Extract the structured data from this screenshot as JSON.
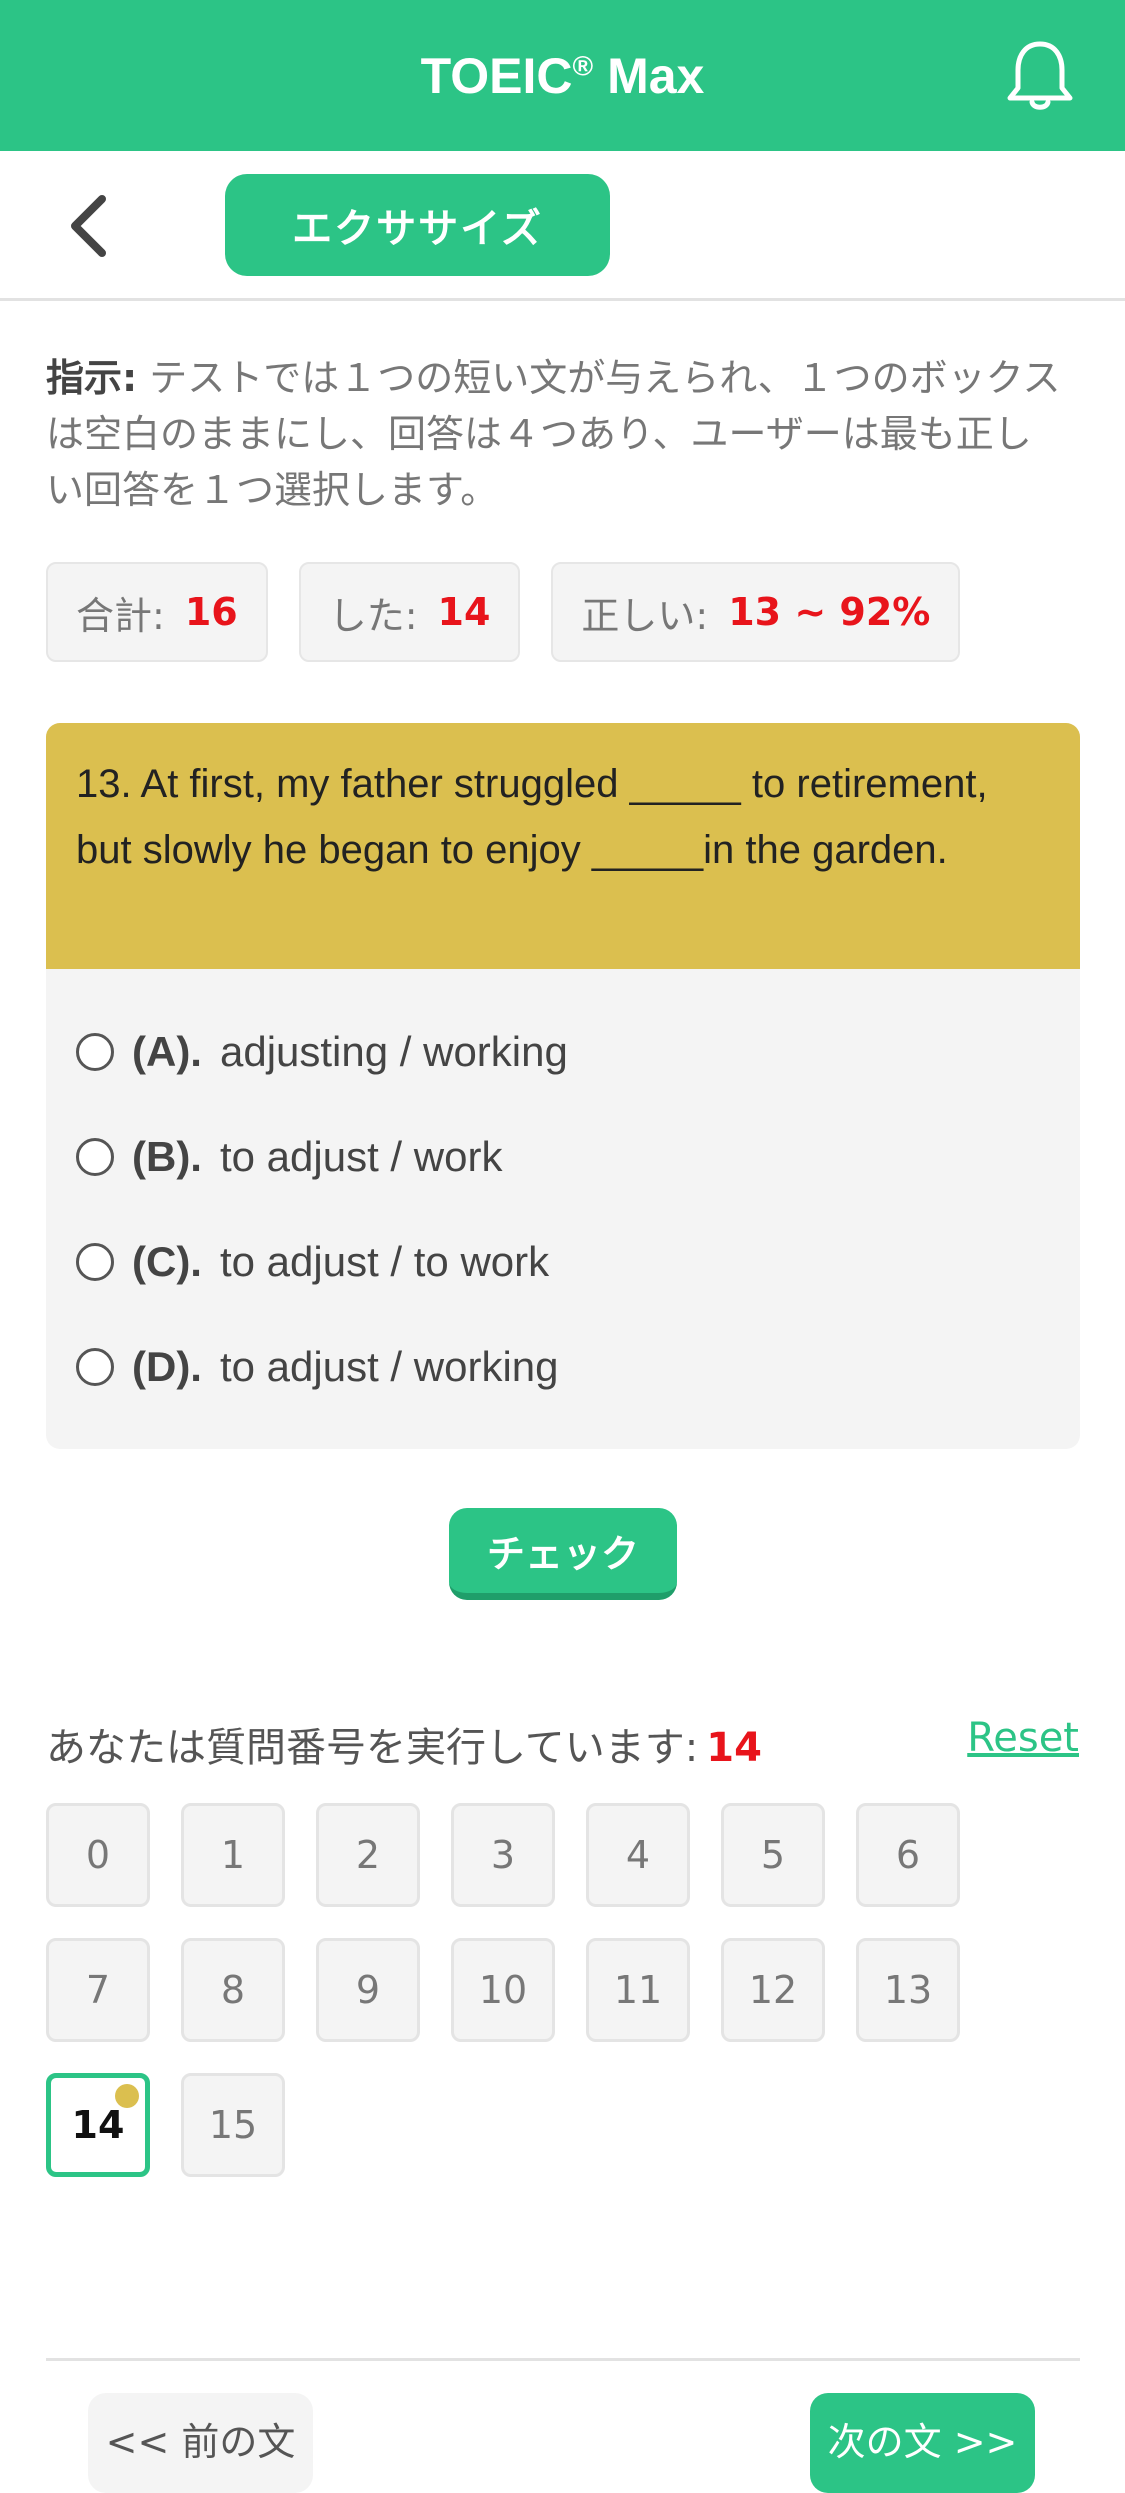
{
  "header": {
    "title": "TOEIC",
    "title_mark": "®",
    "title_suffix": " Max",
    "bell_icon": "bell-icon"
  },
  "subnav": {
    "back_icon": "chevron-left-icon",
    "tab_label": "エクササイズ"
  },
  "instructions": {
    "label": "指示:",
    "text": " テストでは１つの短い文が与えられ、１つのボックスは空白のままにし、回答は４つあり、ユーザーは最も正しい回答を１つ選択します。"
  },
  "stats": [
    {
      "label": "合計:",
      "value": "16"
    },
    {
      "label": "した:",
      "value": "14"
    },
    {
      "label": "正しい:",
      "value": "13 ~ 92%"
    }
  ],
  "question": {
    "text": "13. At first, my father struggled _____ to retirement, but slowly he began to enjoy _____in the garden.",
    "options": [
      {
        "label": "(A).",
        "text": "adjusting / working"
      },
      {
        "label": "(B).",
        "text": "to adjust / work"
      },
      {
        "label": "(C).",
        "text": "to adjust / to work"
      },
      {
        "label": "(D).",
        "text": "to adjust / working"
      }
    ]
  },
  "check_label": "チェック",
  "progress": {
    "label": "あなたは質問番号を実行しています:",
    "current": "14",
    "reset_label": "Reset"
  },
  "question_numbers": [
    "0",
    "1",
    "2",
    "3",
    "4",
    "5",
    "6",
    "7",
    "8",
    "9",
    "10",
    "11",
    "12",
    "13",
    "14",
    "15"
  ],
  "active_question": "14",
  "footer": {
    "prev_label": "<< 前の文",
    "next_label": "次の文 >>"
  },
  "colors": {
    "brand": "#2cc486",
    "question_bg": "#dbbf4f",
    "highlight": "#e8141b"
  }
}
